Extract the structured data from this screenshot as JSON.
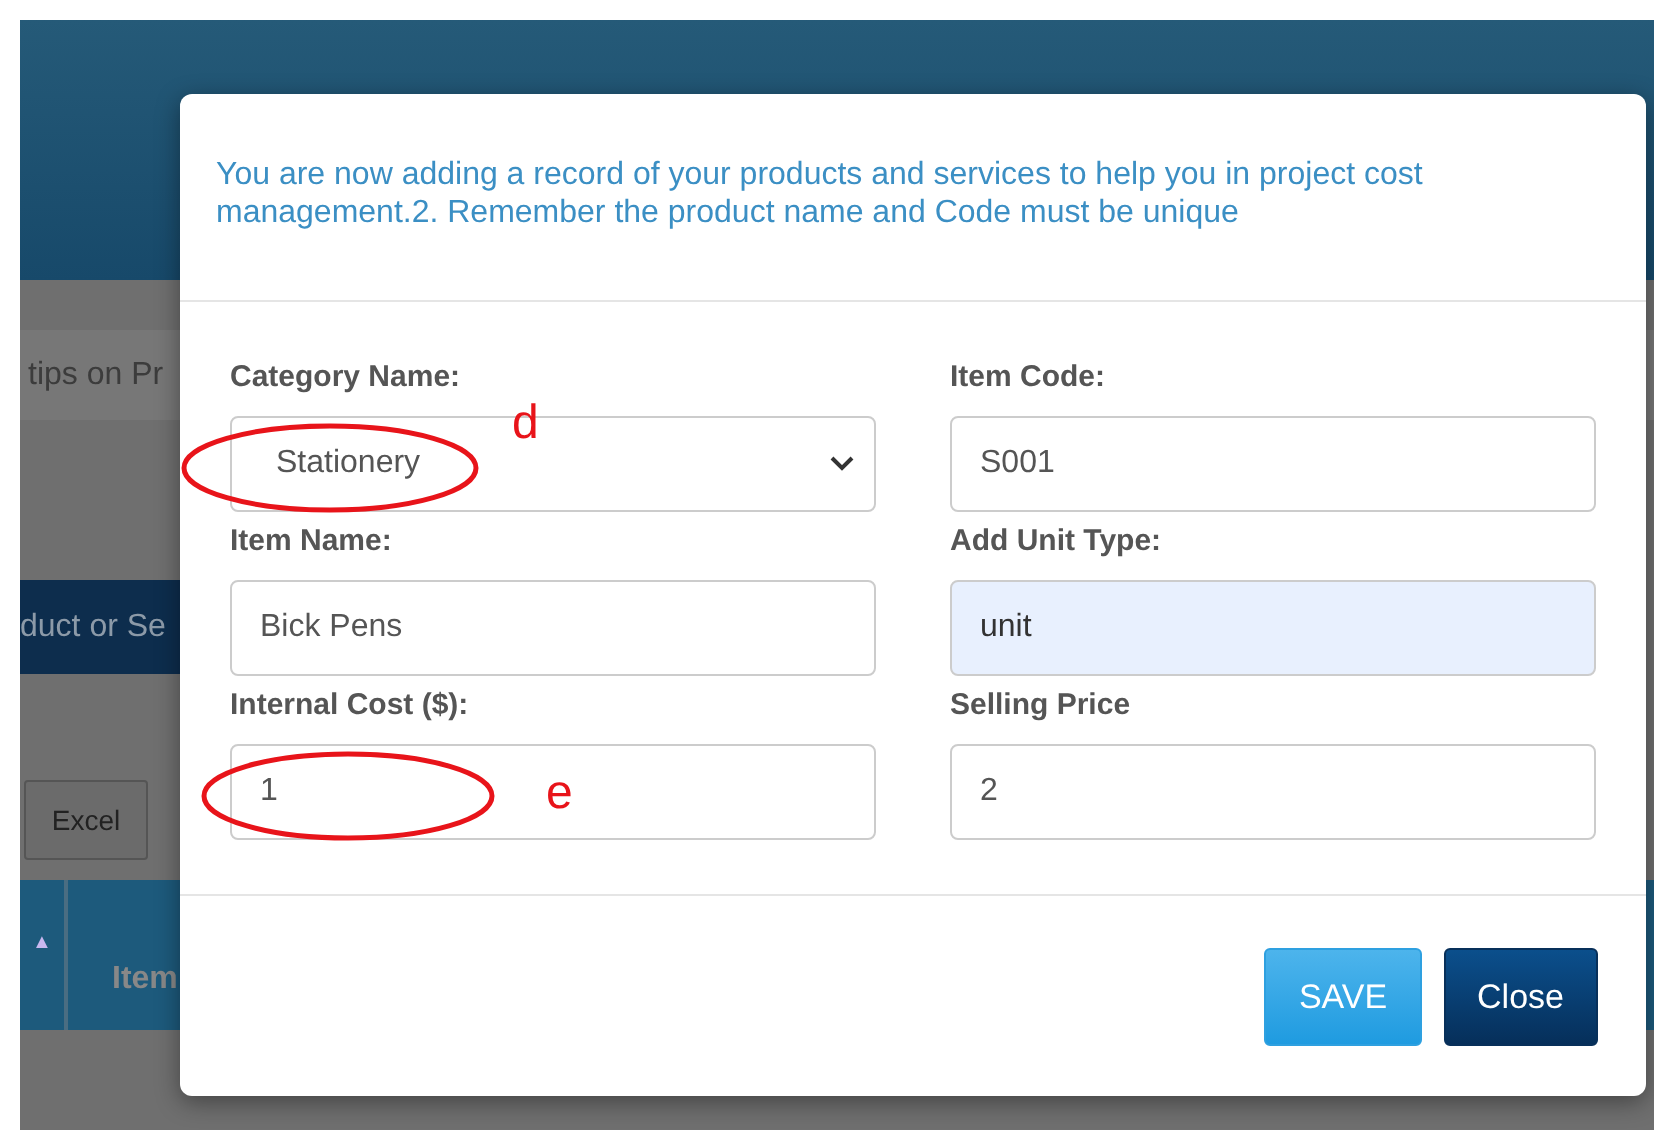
{
  "background": {
    "tips_text": "tips on Pr",
    "add_button": "duct or Se",
    "excel_button": "Excel",
    "table": {
      "sort_marker": "▲",
      "columns": [
        "Item"
      ]
    }
  },
  "dialog": {
    "intro": "You are now adding a record of your products and services to help you in project cost management.2. Remember the product name and Code must be unique",
    "fields": [
      {
        "label": "Category Name:",
        "kind": "select",
        "value": "Stationery",
        "highlighted": false
      },
      {
        "label": "Item Code:",
        "kind": "text",
        "value": "S001",
        "highlighted": false
      },
      {
        "label": "Item Name:",
        "kind": "text",
        "value": "Bick Pens",
        "highlighted": false
      },
      {
        "label": "Add Unit Type:",
        "kind": "text",
        "value": "unit",
        "highlighted": true
      },
      {
        "label": "Internal Cost ($):",
        "kind": "text",
        "value": "1",
        "highlighted": false
      },
      {
        "label": "Selling Price",
        "kind": "text",
        "value": "2",
        "highlighted": false
      }
    ],
    "buttons": [
      {
        "label": "SAVE",
        "kind": "primary"
      },
      {
        "label": "Close",
        "kind": "secondary"
      }
    ]
  },
  "annotations": [
    {
      "letter": "d"
    },
    {
      "letter": "e"
    }
  ]
}
